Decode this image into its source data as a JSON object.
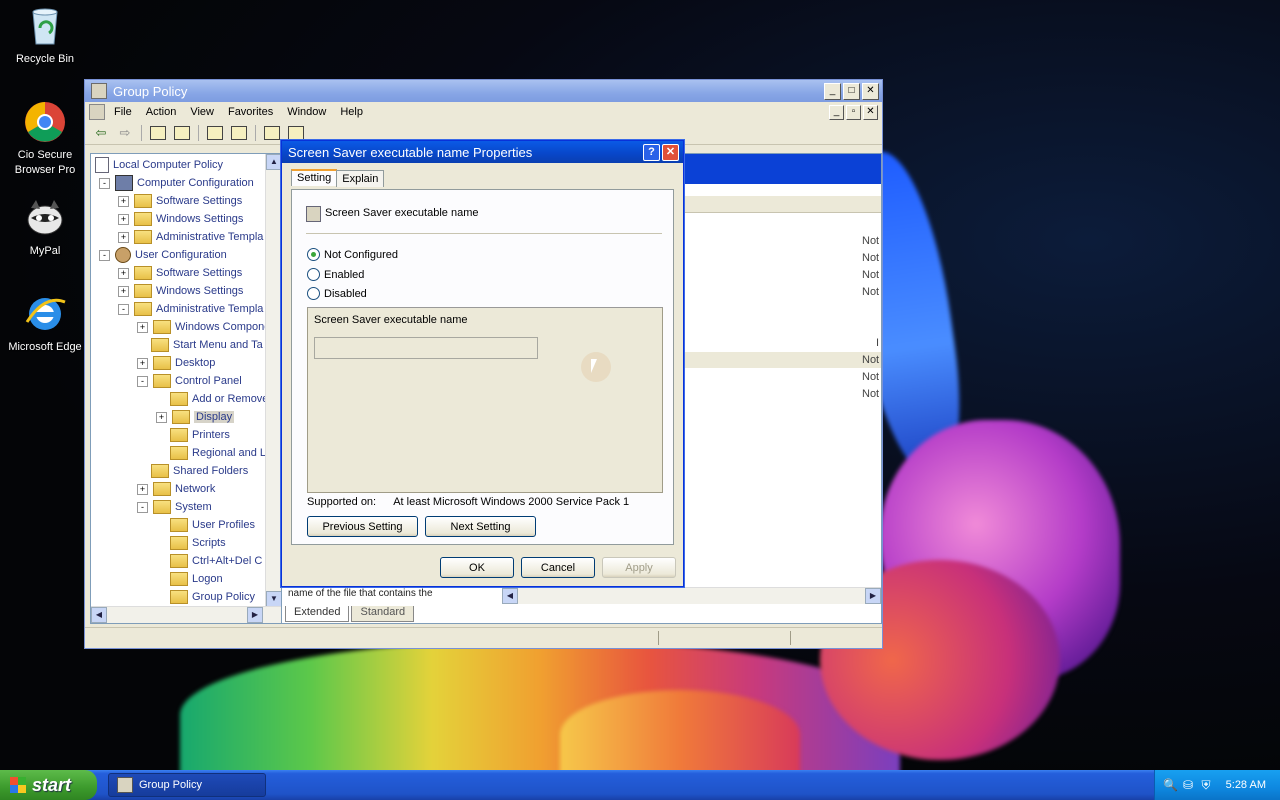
{
  "desktop": {
    "icons": [
      {
        "label": "Recycle Bin",
        "icon": "recycle-bin-icon"
      },
      {
        "label": "Cio Secure Browser Pro",
        "icon": "chrome-icon"
      },
      {
        "label": "MyPal",
        "icon": "raccoon-icon"
      },
      {
        "label": "Microsoft Edge",
        "icon": "ie-edge-icon"
      }
    ]
  },
  "window": {
    "title": "Group Policy",
    "menu": [
      "File",
      "Action",
      "View",
      "Favorites",
      "Window",
      "Help"
    ],
    "tree": [
      {
        "label": "Local Computer Policy",
        "level": 0,
        "exp": "none",
        "kind": "doc"
      },
      {
        "label": "Computer Configuration",
        "level": 1,
        "exp": "-",
        "kind": "pc"
      },
      {
        "label": "Software Settings",
        "level": 2,
        "exp": "+",
        "kind": "folder"
      },
      {
        "label": "Windows Settings",
        "level": 2,
        "exp": "+",
        "kind": "folder"
      },
      {
        "label": "Administrative Templa",
        "level": 2,
        "exp": "+",
        "kind": "folder"
      },
      {
        "label": "User Configuration",
        "level": 1,
        "exp": "-",
        "kind": "user"
      },
      {
        "label": "Software Settings",
        "level": 2,
        "exp": "+",
        "kind": "folder"
      },
      {
        "label": "Windows Settings",
        "level": 2,
        "exp": "+",
        "kind": "folder"
      },
      {
        "label": "Administrative Templa",
        "level": 2,
        "exp": "-",
        "kind": "folder"
      },
      {
        "label": "Windows Compone",
        "level": 3,
        "exp": "+",
        "kind": "folder"
      },
      {
        "label": "Start Menu and Ta",
        "level": 3,
        "exp": "none",
        "kind": "folder"
      },
      {
        "label": "Desktop",
        "level": 3,
        "exp": "+",
        "kind": "folder"
      },
      {
        "label": "Control Panel",
        "level": 3,
        "exp": "-",
        "kind": "folder"
      },
      {
        "label": "Add or Remove",
        "level": 4,
        "exp": "none",
        "kind": "folder"
      },
      {
        "label": "Display",
        "level": 4,
        "exp": "+",
        "kind": "folder",
        "selected": true
      },
      {
        "label": "Printers",
        "level": 4,
        "exp": "none",
        "kind": "folder"
      },
      {
        "label": "Regional and L",
        "level": 4,
        "exp": "none",
        "kind": "folder"
      },
      {
        "label": "Shared Folders",
        "level": 3,
        "exp": "none",
        "kind": "folder"
      },
      {
        "label": "Network",
        "level": 3,
        "exp": "+",
        "kind": "folder"
      },
      {
        "label": "System",
        "level": 3,
        "exp": "-",
        "kind": "folder"
      },
      {
        "label": "User Profiles",
        "level": 4,
        "exp": "none",
        "kind": "folder"
      },
      {
        "label": "Scripts",
        "level": 4,
        "exp": "none",
        "kind": "folder"
      },
      {
        "label": "Ctrl+Alt+Del C",
        "level": 4,
        "exp": "none",
        "kind": "folder"
      },
      {
        "label": "Logon",
        "level": 4,
        "exp": "none",
        "kind": "folder"
      },
      {
        "label": "Group Policy",
        "level": 4,
        "exp": "none",
        "kind": "folder"
      }
    ],
    "right_values": [
      "Not",
      "Not",
      "Not",
      "Not",
      "I",
      "Not",
      "Not",
      "Not"
    ],
    "explain_text": "name of the file that contains the",
    "bottom_tabs": [
      "Extended",
      "Standard"
    ]
  },
  "dialog": {
    "title": "Screen Saver executable name Properties",
    "help_glyph": "?",
    "close_glyph": "✕",
    "tabs": [
      "Setting",
      "Explain"
    ],
    "policy_name": "Screen Saver executable name",
    "options": [
      {
        "label": "Not Configured",
        "checked": true
      },
      {
        "label": "Enabled",
        "checked": false
      },
      {
        "label": "Disabled",
        "checked": false
      }
    ],
    "option_box_label": "Screen Saver executable name",
    "option_box_value": "",
    "supported_label": "Supported on:",
    "supported_value": "At least Microsoft Windows 2000 Service Pack 1",
    "prev_button": "Previous Setting",
    "next_button": "Next Setting",
    "ok_button": "OK",
    "cancel_button": "Cancel",
    "apply_button": "Apply"
  },
  "taskbar": {
    "start_label": "start",
    "task_label": "Group Policy",
    "clock": "5:28 AM"
  }
}
